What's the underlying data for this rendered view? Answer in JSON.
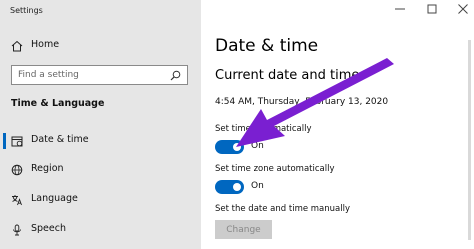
{
  "app": {
    "title": "Settings"
  },
  "sidebar": {
    "home_label": "Home",
    "search_placeholder": "Find a setting",
    "section_title": "Time & Language",
    "items": [
      {
        "label": "Date & time",
        "icon": "calendar-icon",
        "selected": true
      },
      {
        "label": "Region",
        "icon": "globe-icon",
        "selected": false
      },
      {
        "label": "Language",
        "icon": "language-icon",
        "selected": false
      },
      {
        "label": "Speech",
        "icon": "microphone-icon",
        "selected": false
      }
    ]
  },
  "main": {
    "page_title": "Date & time",
    "section_title": "Current date and time",
    "current_datetime": "4:54 AM, Thursday, February 13, 2020",
    "settings": [
      {
        "label": "Set time automatically",
        "state": "On"
      },
      {
        "label": "Set time zone automatically",
        "state": "On"
      }
    ],
    "manual_label": "Set the date and time manually",
    "change_button": "Change"
  },
  "colors": {
    "accent": "#0067c0",
    "annotation_arrow": "#7a1fd1",
    "sidebar_bg": "#e6e6e6"
  }
}
